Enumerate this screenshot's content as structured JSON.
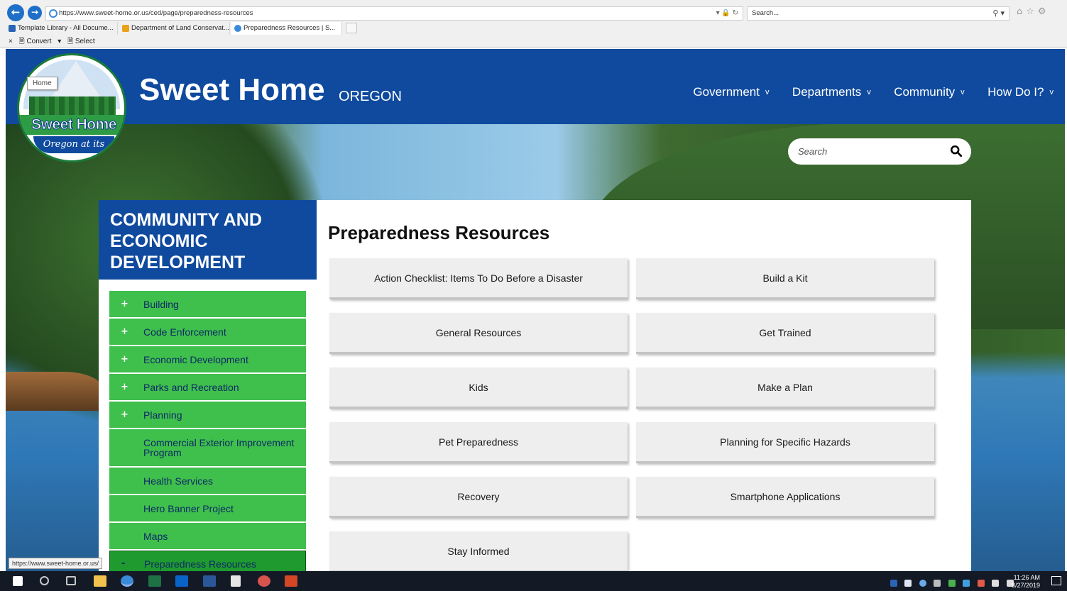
{
  "browser": {
    "url": "https://www.sweet-home.or.us/ced/page/preparedness-resources",
    "search_placeholder": "Search...",
    "tabs": [
      {
        "label": "Template Library - All Docume...",
        "color": "#2b63b5"
      },
      {
        "label": "Department of Land Conservat...",
        "color": "#e8a21d"
      },
      {
        "label": "Preparedness Resources | S...",
        "color": "#3b8ad9"
      }
    ],
    "tab_close": "×",
    "command_close": "×",
    "commands": [
      "Convert",
      "Select"
    ],
    "status_url": "https://www.sweet-home.or.us/"
  },
  "site": {
    "title": "Sweet Home",
    "subtitle": "OREGON",
    "logo_name": "Sweet Home",
    "logo_tagline": "Oregon at its best!",
    "home_tooltip": "Home",
    "nav": [
      {
        "label": "Government"
      },
      {
        "label": "Departments"
      },
      {
        "label": "Community"
      },
      {
        "label": "How Do I?"
      }
    ],
    "nav_chevron": "v",
    "search_placeholder": "Search"
  },
  "sidebar": {
    "heading": "COMMUNITY AND ECONOMIC DEVELOPMENT",
    "items": [
      {
        "label": "Building",
        "expand": "+"
      },
      {
        "label": "Code Enforcement",
        "expand": "+"
      },
      {
        "label": "Economic Development",
        "expand": "+"
      },
      {
        "label": "Parks and Recreation",
        "expand": "+"
      },
      {
        "label": "Planning",
        "expand": "+"
      },
      {
        "label": "Commercial Exterior Improvement Program",
        "expand": ""
      },
      {
        "label": "Health Services",
        "expand": ""
      },
      {
        "label": "Hero Banner Project",
        "expand": ""
      },
      {
        "label": "Maps",
        "expand": ""
      },
      {
        "label": "Preparedness Resources",
        "expand": "-"
      }
    ]
  },
  "main": {
    "title": "Preparedness Resources",
    "buttons": [
      "Action Checklist: Items To Do Before a Disaster",
      "Build a Kit",
      "General Resources",
      "Get Trained",
      "Kids",
      "Make a Plan",
      "Pet Preparedness",
      "Planning for Specific Hazards",
      "Recovery",
      "Smartphone Applications",
      "Stay Informed"
    ]
  },
  "taskbar": {
    "time": "11:26 AM",
    "date": "8/27/2019",
    "apps": [
      {
        "name": "start-icon",
        "color": "#ffffff"
      },
      {
        "name": "search-icon",
        "color": "#c8c8c8"
      },
      {
        "name": "task-view-icon",
        "color": "#c8c8c8"
      },
      {
        "name": "file-explorer-icon",
        "color": "#f2c14e"
      },
      {
        "name": "internet-explorer-icon",
        "color": "#3b8ad9"
      },
      {
        "name": "excel-icon",
        "color": "#1e7145"
      },
      {
        "name": "outlook-icon",
        "color": "#0a64c8"
      },
      {
        "name": "word-icon",
        "color": "#2b579a"
      },
      {
        "name": "calculator-icon",
        "color": "#e6e6e6"
      },
      {
        "name": "paint-icon",
        "color": "#d9534f"
      },
      {
        "name": "powerpoint-icon",
        "color": "#d24726"
      }
    ]
  }
}
